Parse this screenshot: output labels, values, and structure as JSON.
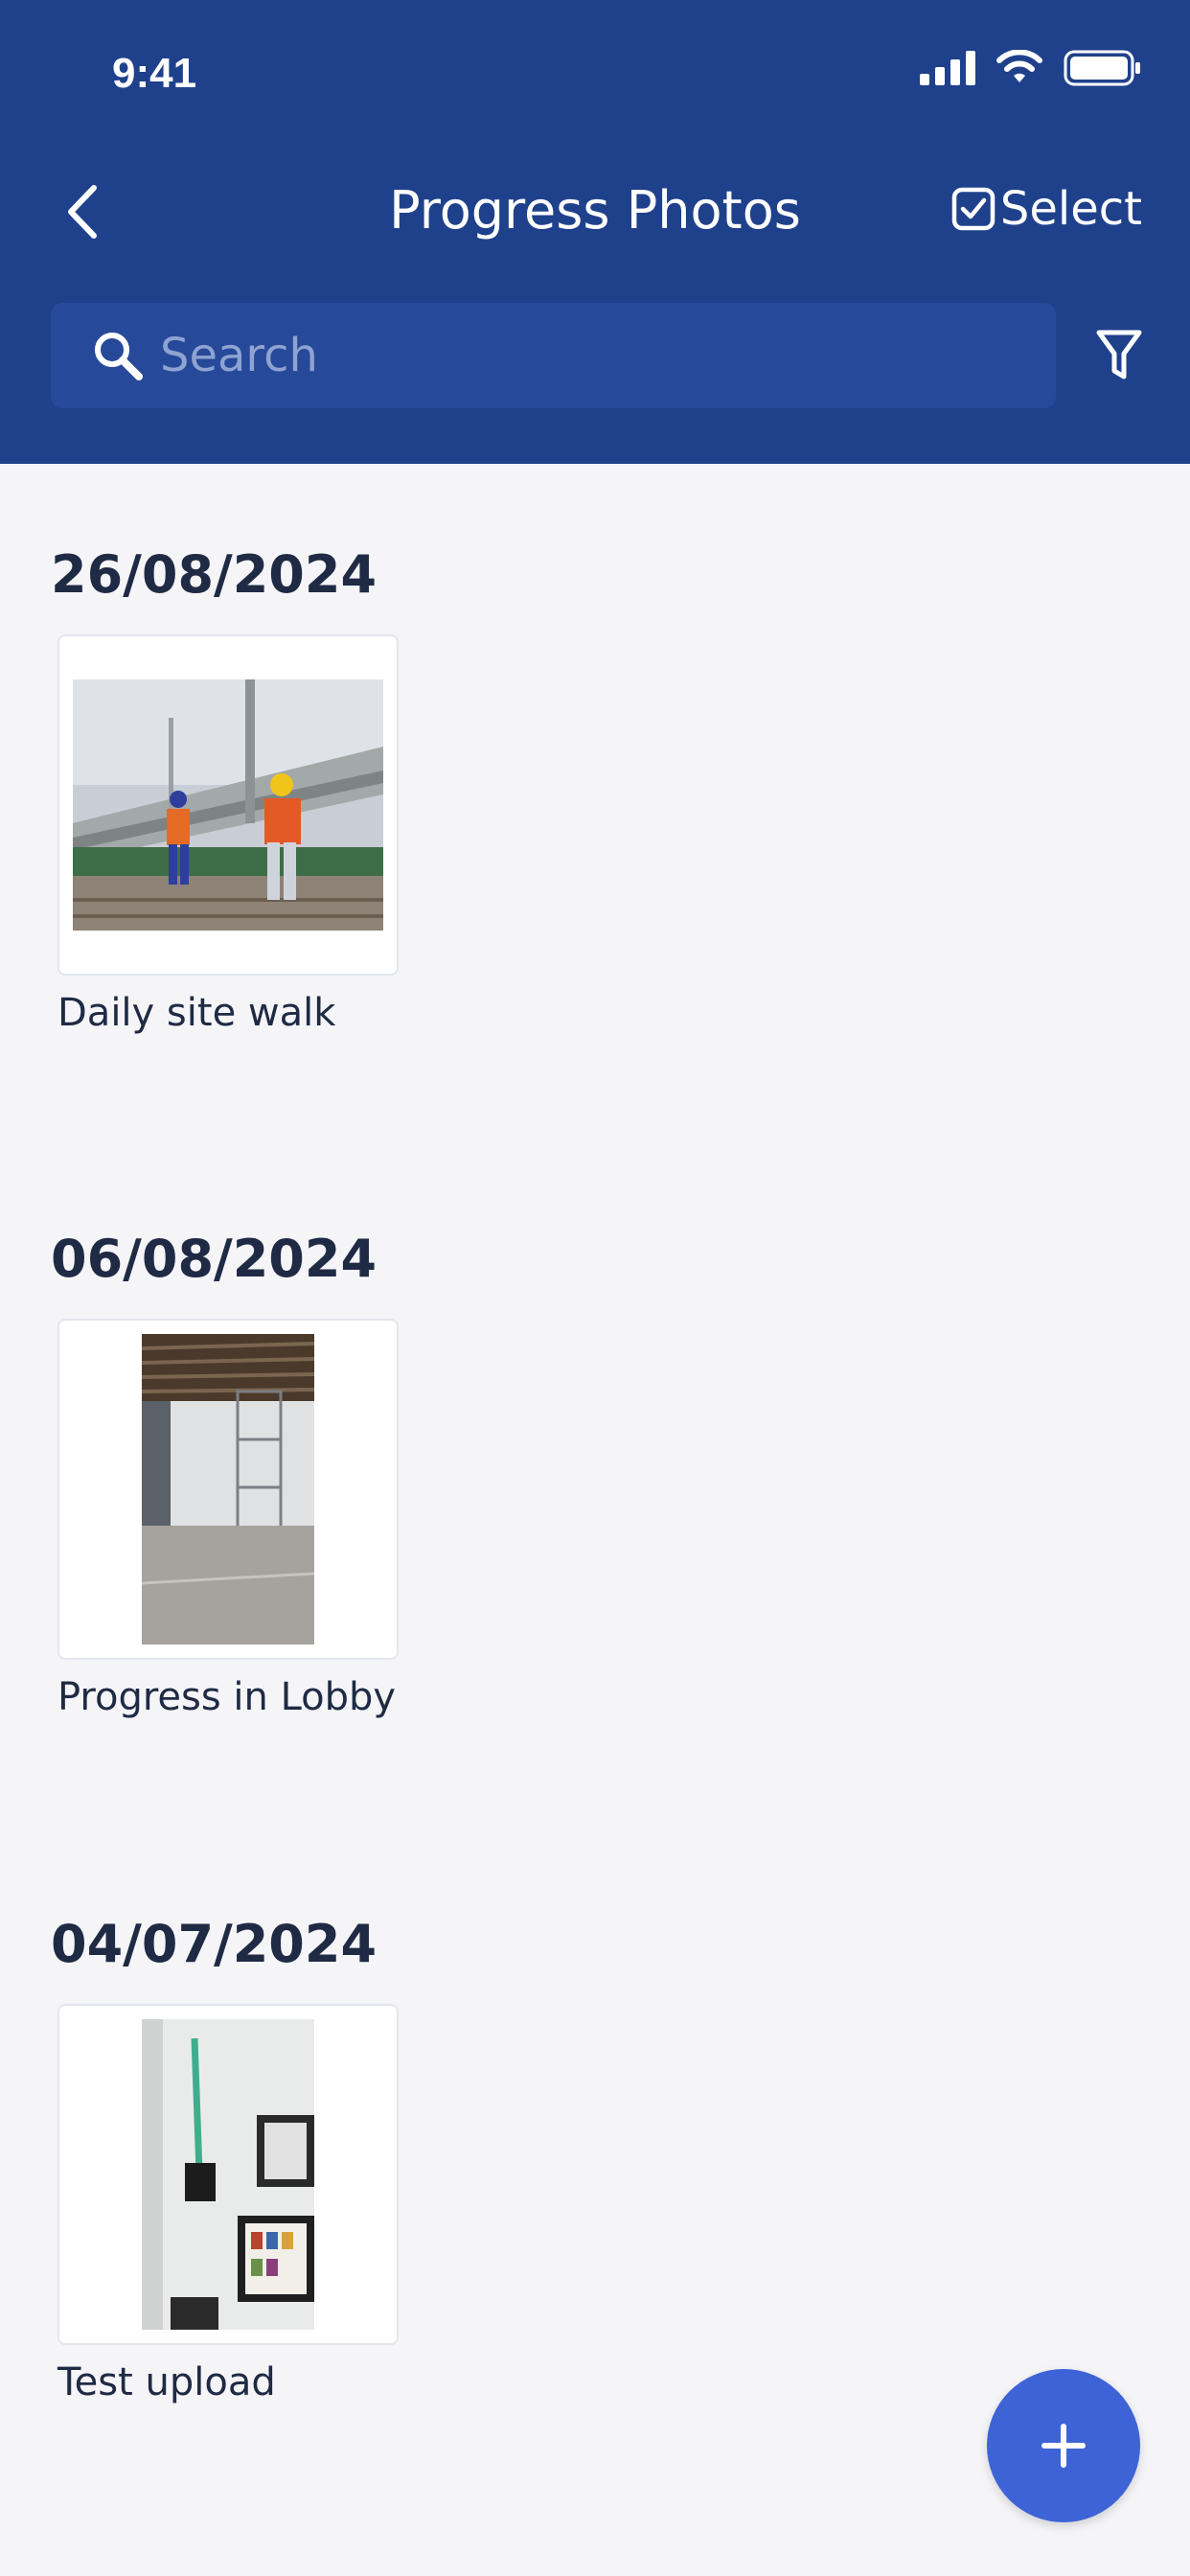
{
  "status_bar": {
    "time": "9:41"
  },
  "nav": {
    "title": "Progress Photos",
    "select_label": "Select"
  },
  "search": {
    "placeholder": "Search",
    "value": ""
  },
  "groups": [
    {
      "date": "26/08/2024",
      "photos": [
        {
          "caption": "Daily site walk"
        }
      ]
    },
    {
      "date": "06/08/2024",
      "photos": [
        {
          "caption": "Progress in Lobby"
        }
      ]
    },
    {
      "date": "04/07/2024",
      "photos": [
        {
          "caption": "Test upload"
        }
      ]
    }
  ],
  "fab": {
    "icon": "plus-icon"
  },
  "colors": {
    "header": "#1f418c",
    "search_field": "#27499a",
    "fab": "#3d63d6",
    "background": "#f5f5f8"
  }
}
